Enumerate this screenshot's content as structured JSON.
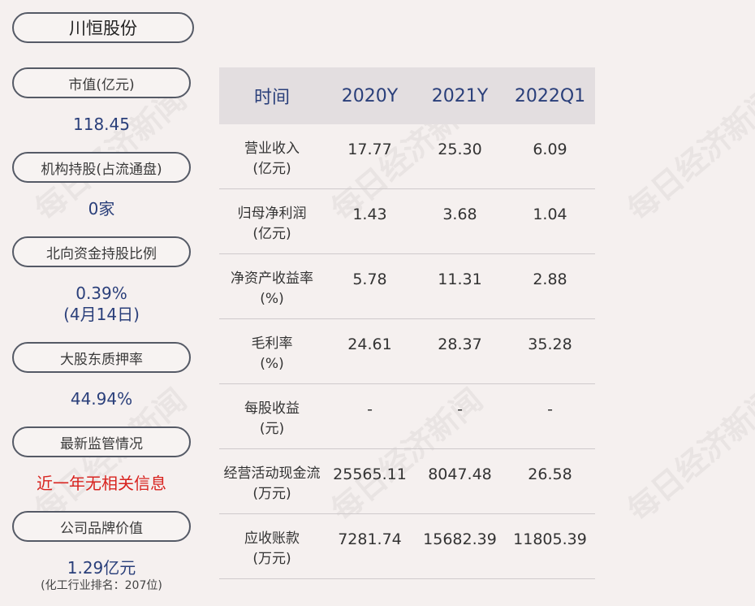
{
  "company": "川恒股份",
  "metrics": [
    {
      "label": "市值(亿元)",
      "value": "118.45"
    },
    {
      "label": "机构持股(占流通盘)",
      "value": "0家"
    },
    {
      "label": "北向资金持股比例",
      "value": "0.39%",
      "value2": "(4月14日)"
    },
    {
      "label": "大股东质押率",
      "value": "44.94%"
    },
    {
      "label": "最新监管情况",
      "value": "近一年无相关信息"
    },
    {
      "label": "公司品牌价值",
      "value": "1.29亿元",
      "note": "(化工行业排名：207位)"
    }
  ],
  "table": {
    "headers": [
      "时间",
      "2020Y",
      "2021Y",
      "2022Q1"
    ],
    "rows": [
      {
        "name": "营业收入",
        "unit": "(亿元)",
        "values": [
          "17.77",
          "25.30",
          "6.09"
        ]
      },
      {
        "name": "归母净利润",
        "unit": "(亿元)",
        "values": [
          "1.43",
          "3.68",
          "1.04"
        ]
      },
      {
        "name": "净资产收益率",
        "unit": "(%)",
        "values": [
          "5.78",
          "11.31",
          "2.88"
        ]
      },
      {
        "name": "毛利率",
        "unit": "(%)",
        "values": [
          "24.61",
          "28.37",
          "35.28"
        ]
      },
      {
        "name": "每股收益",
        "unit": "(元)",
        "values": [
          "-",
          "-",
          "-"
        ]
      },
      {
        "name": "经营活动现金流",
        "unit": "(万元)",
        "values": [
          "25565.11",
          "8047.48",
          "26.58"
        ]
      },
      {
        "name": "应收账款",
        "unit": "(万元)",
        "values": [
          "7281.74",
          "15682.39",
          "11805.39"
        ]
      }
    ]
  },
  "watermark": "每日经济新闻"
}
